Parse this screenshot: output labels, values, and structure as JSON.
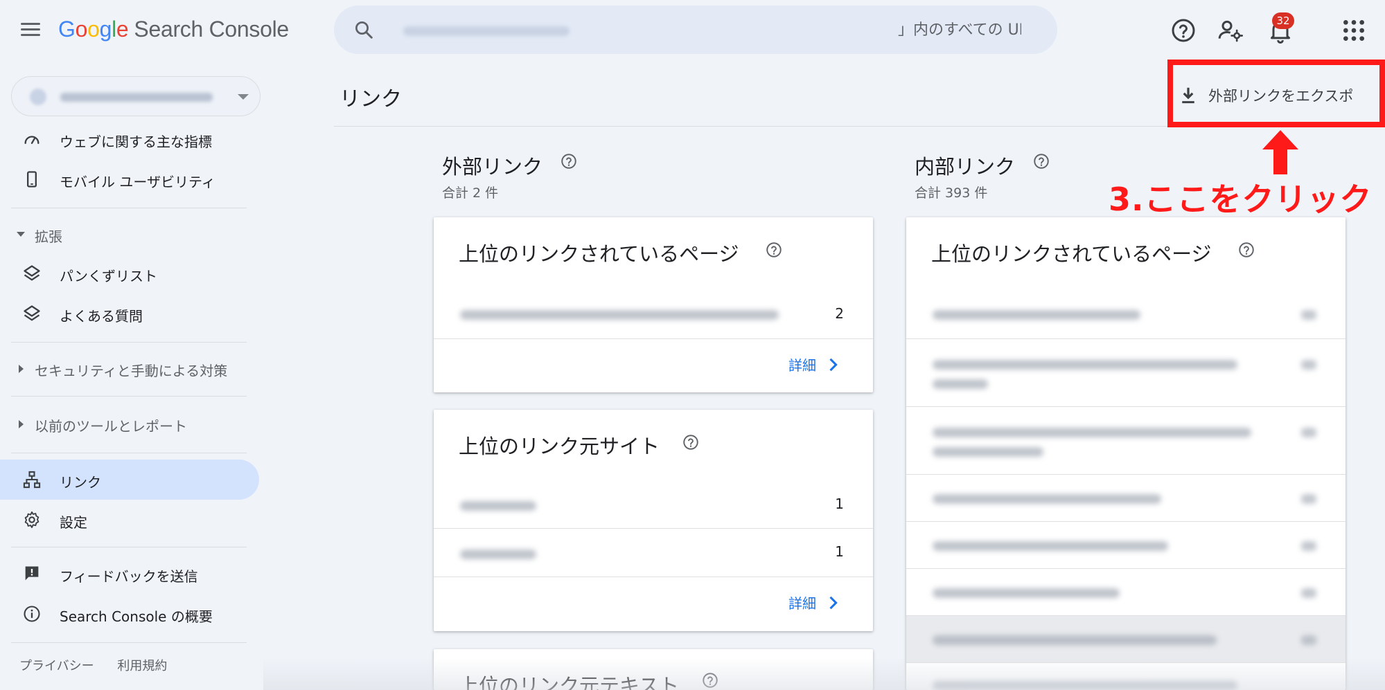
{
  "app": {
    "logo_letters": [
      "G",
      "o",
      "o",
      "g",
      "l",
      "e"
    ],
    "product": "Search Console",
    "notification_count": "32"
  },
  "search": {
    "placeholder": "」内のすべての URL を検査"
  },
  "sidebar": {
    "items": [
      {
        "label": "ウェブに関する主な指標",
        "icon": "gauge-icon"
      },
      {
        "label": "モバイル ユーザビリティ",
        "icon": "smartphone-icon"
      },
      {
        "label": "パンくずリスト",
        "icon": "layers-icon"
      },
      {
        "label": "よくある質問",
        "icon": "layers-icon"
      },
      {
        "label": "リンク",
        "icon": "sitemap-icon"
      },
      {
        "label": "設定",
        "icon": "gear-icon"
      },
      {
        "label": "フィードバックを送信",
        "icon": "feedback-icon"
      },
      {
        "label": "Search Console の概要",
        "icon": "info-icon"
      }
    ],
    "sections": [
      {
        "label": "拡張",
        "expanded": true
      },
      {
        "label": "セキュリティと手動による対策",
        "expanded": false
      },
      {
        "label": "以前のツールとレポート",
        "expanded": false
      }
    ],
    "footer": [
      "プライバシー",
      "利用規約"
    ]
  },
  "header": {
    "title": "リンク",
    "export_label": "外部リンクをエクスポ"
  },
  "annotation": {
    "text": "3.ここをクリック",
    "color": "#ff1a1a"
  },
  "external": {
    "title": "外部リンク",
    "total": "合計 2 件",
    "cards": [
      {
        "title": "上位のリンクされているページ",
        "rows": [
          {
            "count": "2"
          }
        ],
        "detail": "詳細"
      },
      {
        "title": "上位のリンク元サイト",
        "rows": [
          {
            "count": "1"
          },
          {
            "count": "1"
          }
        ],
        "detail": "詳細"
      },
      {
        "title": "上位のリンク元テキスト"
      }
    ]
  },
  "internal": {
    "title": "内部リンク",
    "total": "合計 393 件",
    "cards": [
      {
        "title": "上位のリンクされているページ"
      }
    ]
  },
  "colors": {
    "background": "#f0f4f9",
    "accent": "#1a73e8",
    "active_nav": "#d3e3fd",
    "badge": "#d93025"
  }
}
